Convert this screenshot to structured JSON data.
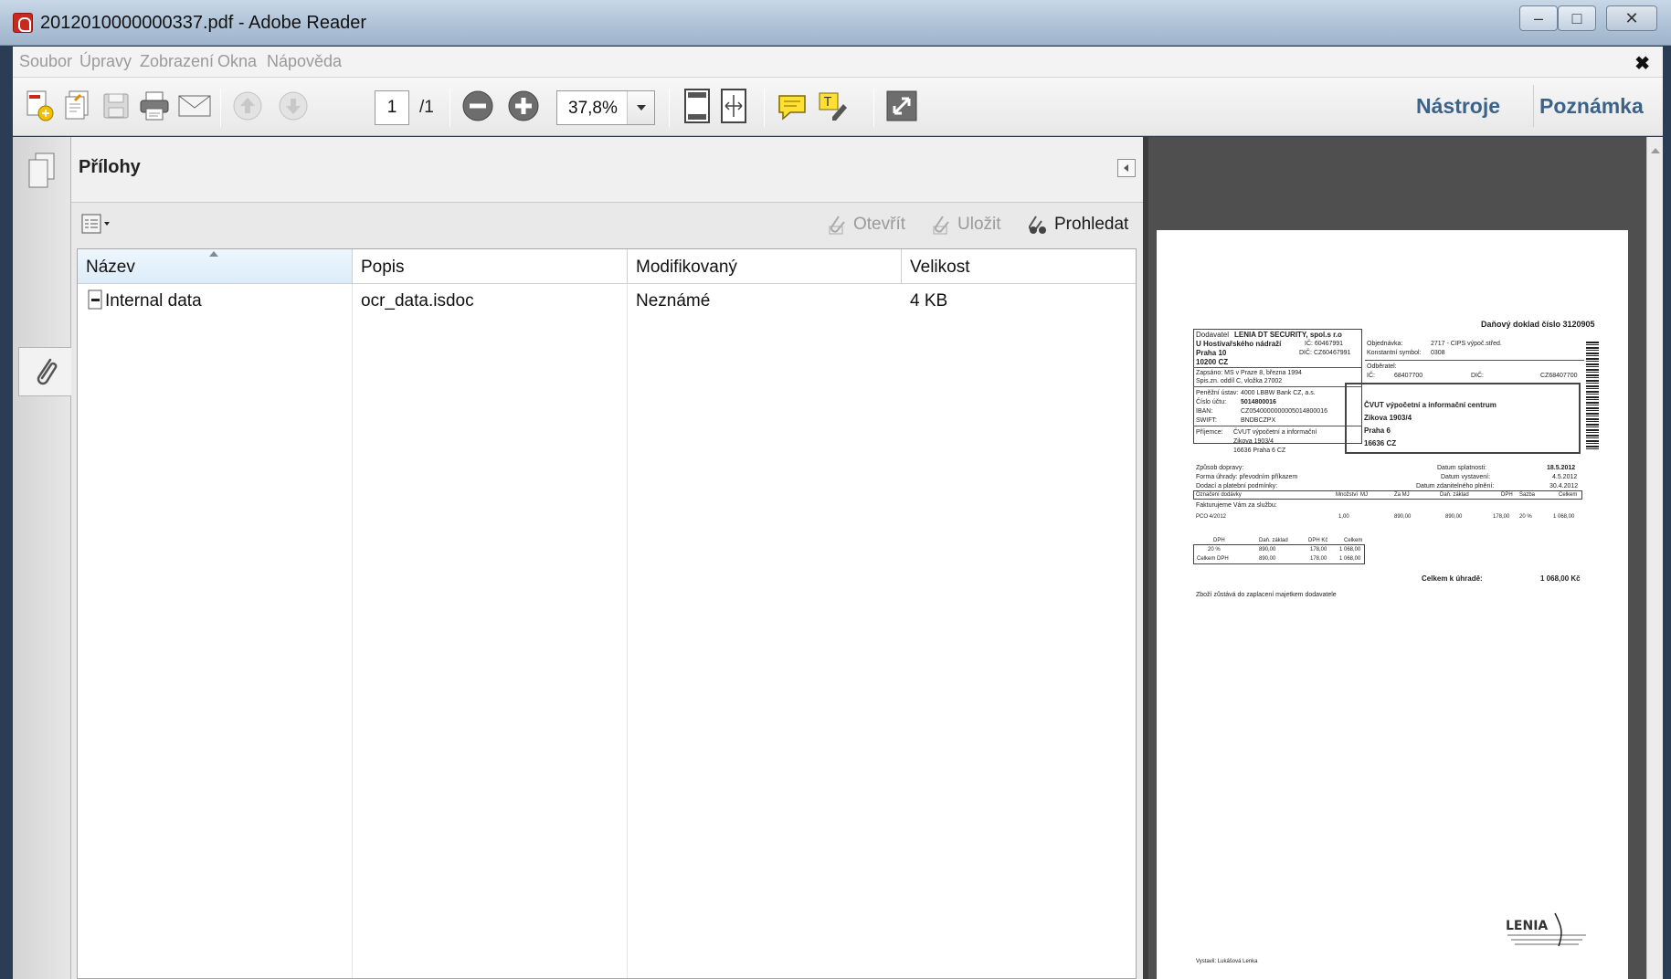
{
  "window": {
    "title": "2012010000000337.pdf - Adobe Reader",
    "controls": {
      "minimize": "–",
      "maximize": "□",
      "close": "✕"
    }
  },
  "menu": {
    "items": [
      "Soubor",
      "Úpravy",
      "Zobrazení",
      "Okna",
      "Nápověda"
    ],
    "close_document": "✖"
  },
  "toolbar": {
    "icons": [
      "create-pdf-icon",
      "export-icon",
      "save-icon",
      "print-icon",
      "email-icon",
      "page-up-icon",
      "page-down-icon",
      "zoom-out-icon",
      "zoom-in-icon",
      "fit-page-icon",
      "fit-width-icon",
      "comment-icon",
      "highlight-icon",
      "fullscreen-icon"
    ],
    "page_current": "1",
    "page_total": "/1",
    "zoom": "37,8%",
    "tools_link": "Nástroje",
    "comments_link": "Poznámka"
  },
  "attachments_panel": {
    "title": "Přílohy",
    "actions": {
      "open": "Otevřít",
      "save": "Uložit",
      "search": "Prohledat"
    },
    "columns": [
      "Název",
      "Popis",
      "Modifikovaný",
      "Velikost"
    ],
    "rows": [
      {
        "name": "Internal data",
        "description": "ocr_data.isdoc",
        "modified": "Neznámé",
        "size": "4 KB"
      }
    ]
  },
  "document_page": {
    "doc_title": "Daňový doklad číslo 3120905",
    "supplier": {
      "label": "Dodavatel",
      "name": "LENIA DT SECURITY, spol.s r.o",
      "street": "U Hostivařského nádraží",
      "city": "Praha 10",
      "zip": "10200  CZ",
      "ic": "IČ: 60467991",
      "dic": "DIČ: CZ60467991",
      "registry1": "Zapsáno: MS v Praze 8, března 1994",
      "registry2": "Spis.zn. oddíl C, vložka 27002"
    },
    "bank": {
      "institution_label": "Peněžní ústav:",
      "institution": "4000   LBBW Bank CZ, a.s.",
      "account_label": "Číslo účtu:",
      "account": "5014800016",
      "iban_label": "IBAN:",
      "iban": "CZ0540000000005014800016",
      "swift_label": "SWIFT:",
      "swift": "BNDBCZPX"
    },
    "recipient": {
      "label": "Příjemce:",
      "line1": "ČVUT výpočetní a informační",
      "line2": "Zikova 1903/4",
      "line3": "16636 Praha 6  CZ"
    },
    "order": {
      "order_label": "Objednávka:",
      "order_value": "2717 - CIPS výpoč.střed.",
      "const_label": "Konstantní symbol:",
      "const_value": "0308",
      "buyer_label": "Odběratel:",
      "ic_label": "IČ:",
      "ic_value": "68407700",
      "dic_label": "DIČ:",
      "dic_value": "CZ68407700"
    },
    "buyer_box": {
      "name": "ČVUT výpočetní a informační centrum",
      "street": "Zikova 1903/4",
      "city": "Praha 6",
      "zip": "16636  CZ"
    },
    "terms": {
      "transport": "Způsob dopravy:",
      "payment": "Forma úhrady: převodním příkazem",
      "delivery": "Dodací a platební podmínky:",
      "due_label": "Datum splatnosti:",
      "due": "18.5.2012",
      "issued_label": "Datum vystavení:",
      "issued": "4.5.2012",
      "taxdate_label": "Datum zdanitelného plnění:",
      "taxdate": "30.4.2012"
    },
    "items_header": [
      "Označení dodávky",
      "Množství",
      "MJ",
      "Za MJ",
      "Daň. základ",
      "DPH",
      "Sazba",
      "Celkem"
    ],
    "items_intro": "Fakturujeme Vám za službu:",
    "item_row": [
      "PCO 4/2012",
      "1,00",
      "890,00",
      "890,00",
      "178,00",
      "20 %",
      "1 068,00"
    ],
    "vat_header": [
      "DPH",
      "Daň. základ",
      "DPH Kč",
      "Celkem"
    ],
    "vat_rows": [
      [
        "20 %",
        "890,00",
        "178,00",
        "1 068,00"
      ],
      [
        "Celkem DPH",
        "890,00",
        "178,00",
        "1 068,00"
      ]
    ],
    "total_label": "Celkem k úhradě:",
    "total_value": "1 068,00 Kč",
    "ownership_note": "Zboží zůstává do zaplacení majetkem dodavatele",
    "issued_by": "Vystavil: Lukášová Lenka",
    "stamp_text": "LENIA"
  }
}
